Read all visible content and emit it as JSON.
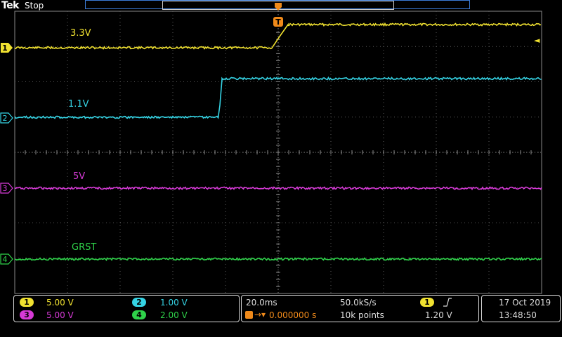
{
  "header": {
    "brand": "Tek",
    "status": "Stop"
  },
  "trigger": {
    "marker_label": "T",
    "level_arrow": "◄"
  },
  "colors": {
    "ch1": "#f0e130",
    "ch2": "#35d3e4",
    "ch3": "#d63ad6",
    "ch4": "#2fd24a",
    "grid": "#5c5c5c",
    "trigger": "#f08a1a"
  },
  "channels": [
    {
      "id": "1",
      "label": "3.3V",
      "color": "#f0e130"
    },
    {
      "id": "2",
      "label": "1.1V",
      "color": "#35d3e4"
    },
    {
      "id": "3",
      "label": "5V",
      "color": "#d63ad6"
    },
    {
      "id": "4",
      "label": "GRST",
      "color": "#2fd24a"
    }
  ],
  "vert_panel": {
    "ch1_scale": "5.00 V",
    "ch2_scale": "1.00 V",
    "ch3_scale": "5.00 V",
    "ch4_scale": "2.00 V"
  },
  "horiz_panel": {
    "timebase": "20.0ms",
    "sample_rate": "50.0kS/s",
    "position": "0.000000 s",
    "record_length": "10k points"
  },
  "trigger_panel": {
    "source": "1",
    "slope_icon": "rising-edge-icon",
    "level": "1.20 V"
  },
  "datetime": {
    "date": "17 Oct  2019",
    "time": "13:48:50"
  }
}
